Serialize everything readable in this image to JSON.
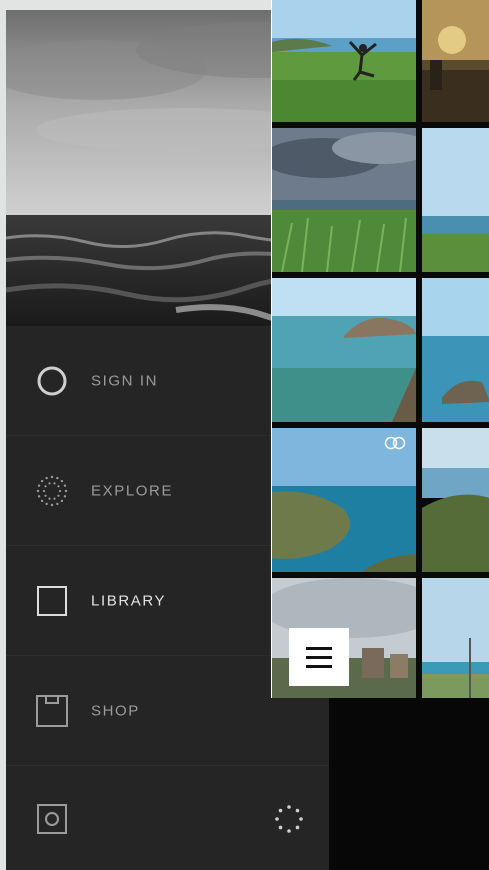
{
  "menu": {
    "items": [
      {
        "id": "sign-in",
        "label": "SIGN IN",
        "icon": "circle-icon",
        "active": false
      },
      {
        "id": "explore",
        "label": "EXPLORE",
        "icon": "dotted-circle-icon",
        "active": false
      },
      {
        "id": "library",
        "label": "LIBRARY",
        "icon": "square-icon",
        "active": true
      },
      {
        "id": "shop",
        "label": "SHOP",
        "icon": "box-icon",
        "active": false
      }
    ],
    "bottom": {
      "left_icon": "camera-icon",
      "right_icon": "spinner-dots-icon"
    }
  },
  "hero": {
    "image": "stormy-sea-photo"
  },
  "library": {
    "thumbnails": [
      "jumping-person-photo",
      "sunset-photo",
      "storm-clouds-grass-photo",
      "blue-sky-field-photo",
      "rock-in-sea-photo",
      "rock-shore-photo",
      "cliff-coast-photo",
      "hillside-sea-photo",
      "cloudy-town-photo",
      "coast-pole-photo"
    ],
    "overlay_icon": "interlocking-rings-icon",
    "menu_button_icon": "hamburger-icon"
  },
  "colors": {
    "drawer_bg": "#252525",
    "frame_bg": "#e2e3e3",
    "label_inactive": "#9b9b9b",
    "label_active": "#e3e3e3"
  }
}
